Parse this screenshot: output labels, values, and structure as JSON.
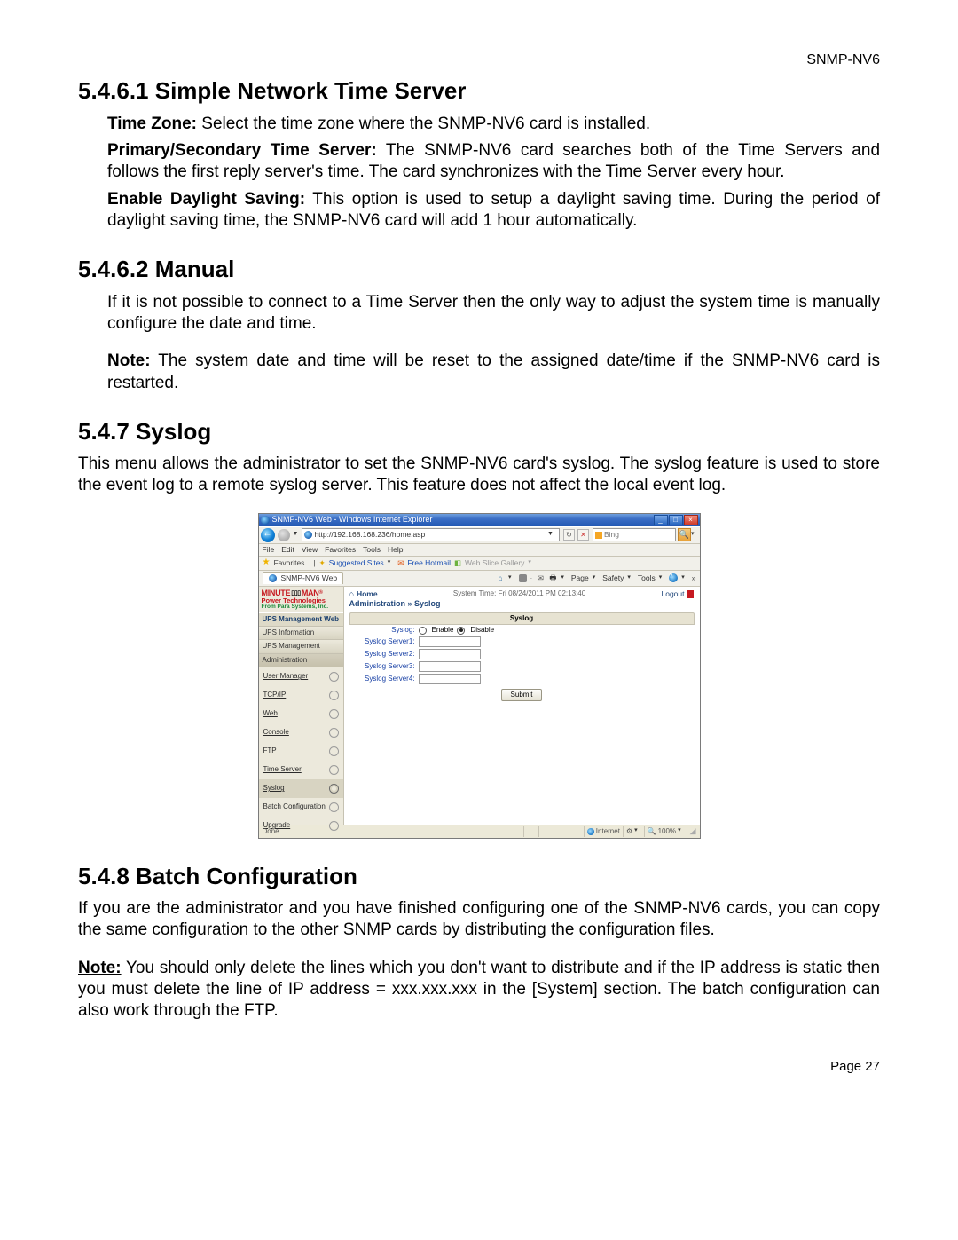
{
  "header": {
    "product": "SNMP-NV6"
  },
  "sec1": {
    "heading": "5.4.6.1 Simple Network Time Server",
    "p1a": "Time Zone:",
    "p1b": " Select the time zone where the SNMP-NV6 card is installed.",
    "p2a": "Primary/Secondary Time Server:",
    "p2b": " The SNMP-NV6 card searches both of the Time Servers and follows the first reply server's time. The card synchronizes with the Time Server every hour.",
    "p3a": "Enable Daylight Saving:",
    "p3b": " This option is used to setup a daylight saving time. During the period of daylight saving time, the SNMP-NV6 card will add 1 hour automatically."
  },
  "sec2": {
    "heading": "5.4.6.2 Manual",
    "p1": "If it is not possible to connect to a Time Server then the only way to adjust the system time is manually configure the date and time.",
    "note_a": "Note:",
    "note_b": " The system date and time will be reset to the assigned date/time if the SNMP-NV6 card is restarted."
  },
  "sec3": {
    "heading": "5.4.7 Syslog",
    "p1": "This menu allows the administrator to set the SNMP-NV6 card's syslog. The syslog feature is used to store the event log to a remote syslog server. This feature does not affect the local event log."
  },
  "sec4": {
    "heading": "5.4.8 Batch Configuration",
    "p1": "If you are the administrator and you have finished configuring one of the SNMP-NV6 cards, you can copy the same configuration to the other SNMP cards by distributing the configuration files.",
    "note_a": "Note:",
    "note_b": " You should only delete the lines which you don't want to distribute and if the IP address is static then you must delete the line of IP address = xxx.xxx.xxx in the [System] section. The batch configuration can also work through the FTP."
  },
  "footer": {
    "page": "Page 27"
  },
  "shot": {
    "title": "SNMP-NV6 Web - Windows Internet Explorer",
    "win_min": "_",
    "win_max": "□",
    "win_close": "×",
    "url": "http://192.168.168.236/home.asp",
    "menu": [
      "File",
      "Edit",
      "View",
      "Favorites",
      "Tools",
      "Help"
    ],
    "favbar": {
      "label": "Favorites",
      "sugg": "Suggested Sites",
      "hotmail": "Free Hotmail",
      "slice": "Web Slice Gallery"
    },
    "search_engine": "Bing",
    "tab": "SNMP-NV6 Web",
    "cmd": {
      "page": "Page",
      "safety": "Safety",
      "tools": "Tools"
    },
    "logo": {
      "l1a": "MINUTE",
      "l1b": "MAN",
      "l2": "Power Technologies",
      "l3": "From Para Systems, Inc."
    },
    "sidebar_head": "UPS Management Web",
    "sidebar_sections": {
      "info": "UPS Information",
      "mgmt": "UPS Management",
      "admin": "Administration"
    },
    "sidebar_items": [
      "User Manager",
      "TCP/IP",
      "Web",
      "Console",
      "FTP",
      "Time Server",
      "Syslog",
      "Batch Configuration",
      "Upgrade"
    ],
    "page_top": {
      "home": "Home",
      "systime": "System Time: Fri 08/24/2011 PM 02:13:40",
      "logout": "Logout"
    },
    "crumb": "Administration » Syslog",
    "panel": {
      "title": "Syslog",
      "row_label": "Syslog:",
      "enable": "Enable",
      "disable": "Disable",
      "s1": "Syslog Server1:",
      "s2": "Syslog Server2:",
      "s3": "Syslog Server3:",
      "s4": "Syslog Server4:",
      "submit": "Submit"
    },
    "status": {
      "done": "Done",
      "zone": "Internet",
      "zoom": "100%"
    }
  }
}
